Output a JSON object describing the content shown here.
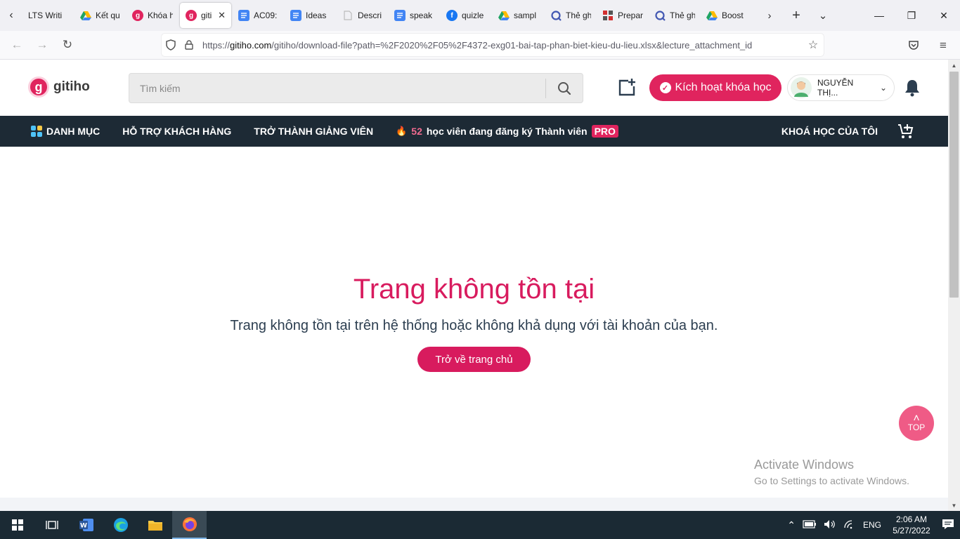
{
  "browser": {
    "tabs": [
      {
        "label": "LTS Writi",
        "icon": "none-icon",
        "color": ""
      },
      {
        "label": "Kết qu",
        "icon": "google-drive-icon",
        "color": "#1fa463"
      },
      {
        "label": "Khóa h",
        "icon": "gitiho-icon",
        "color": "#e0245e"
      },
      {
        "label": "giti",
        "icon": "gitiho-icon",
        "color": "#e0245e",
        "active": true
      },
      {
        "label": "AC09:",
        "icon": "google-docs-icon",
        "color": "#4285f4"
      },
      {
        "label": "Ideas",
        "icon": "google-docs-icon",
        "color": "#4285f4"
      },
      {
        "label": "Descri",
        "icon": "page-icon",
        "color": "#bbbbbb"
      },
      {
        "label": "speak",
        "icon": "google-docs-icon",
        "color": "#4285f4"
      },
      {
        "label": "quizle",
        "icon": "facebook-icon",
        "color": "#1877f2"
      },
      {
        "label": "sampl",
        "icon": "google-drive-icon",
        "color": "#1fa463"
      },
      {
        "label": "Thẻ gh",
        "icon": "quizlet-icon",
        "color": "#4257b2"
      },
      {
        "label": "Prepar",
        "icon": "prep-icon",
        "color": "#d32f2f"
      },
      {
        "label": "Thẻ gh",
        "icon": "quizlet-icon",
        "color": "#4257b2"
      },
      {
        "label": "Boost",
        "icon": "google-drive-icon",
        "color": "#1fa463"
      }
    ],
    "url_prefix": "https://",
    "url_host": "gitiho.com",
    "url_path": "/gitiho/download-file?path=%2F2020%2F05%2F4372-exg01-bai-tap-phan-biet-kieu-du-lieu.xlsx&lecture_attachment_id"
  },
  "header": {
    "logo_text": "gitiho",
    "search_placeholder": "Tìm kiếm",
    "activate_label": "Kích hoạt khóa học",
    "user_name": "NGUYỄN THỊ..."
  },
  "nav": {
    "categories": "DANH MỤC",
    "support": "HỖ TRỢ KHÁCH HÀNG",
    "teacher": "TRỞ THÀNH GIẢNG VIÊN",
    "promo_count": "52",
    "promo_text": "học viên đang đăng ký Thành viên",
    "pro_badge": "PRO",
    "my_courses": "KHOÁ HỌC CỦA TÔI"
  },
  "main": {
    "title": "Trang không tồn tại",
    "subtitle": "Trang không tồn tại trên hệ thống hoặc không khả dụng với tài khoản của bạn.",
    "home_button": "Trở về trang chủ",
    "top_button": "TOP"
  },
  "watermark": {
    "line1": "Activate Windows",
    "line2": "Go to Settings to activate Windows."
  },
  "taskbar": {
    "language": "ENG",
    "time": "2:06 AM",
    "date": "5/27/2022"
  },
  "colors": {
    "brand": "#e0245e",
    "nav_bg": "#1d2a35",
    "taskbar_bg": "#1b2a34"
  }
}
